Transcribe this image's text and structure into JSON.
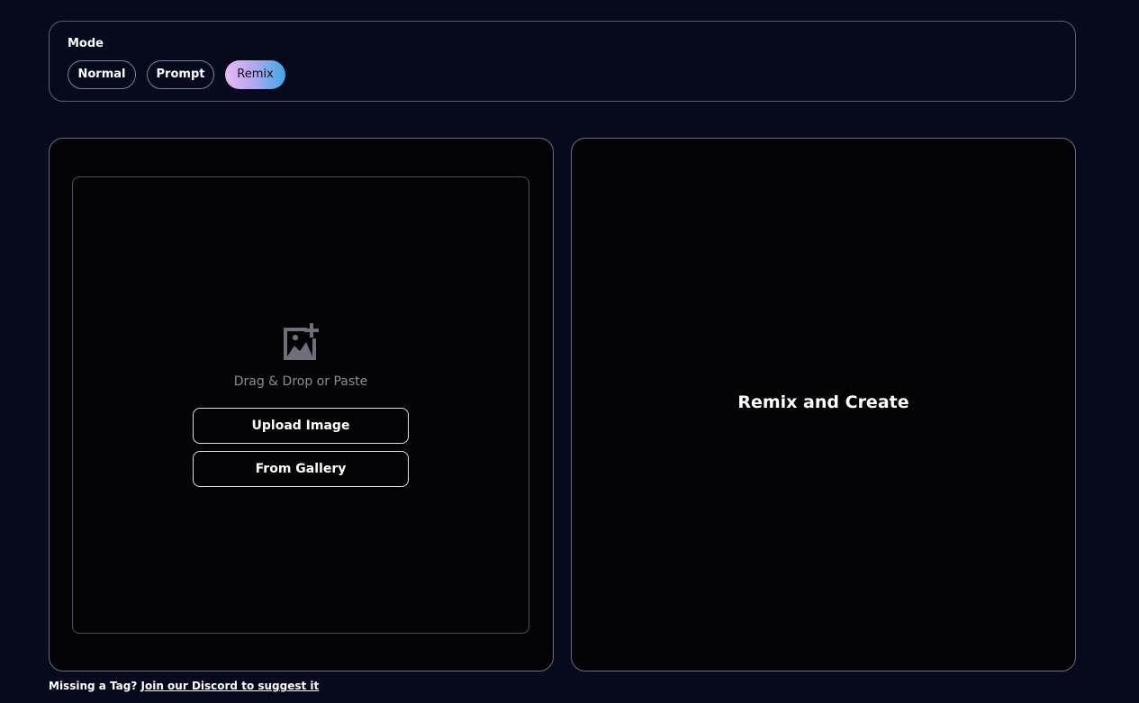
{
  "mode": {
    "label": "Mode",
    "options": [
      "Normal",
      "Prompt",
      "Remix"
    ],
    "selected": "Remix",
    "selected_gradient": [
      "#e8b8f5",
      "#b8a8f0",
      "#3fa7e6"
    ]
  },
  "upload": {
    "icon": "image-plus-icon",
    "drag_text": "Drag & Drop or Paste",
    "upload_button": "Upload Image",
    "gallery_button": "From Gallery"
  },
  "output": {
    "title": "Remix and Create"
  },
  "footer": {
    "question": "Missing a Tag?",
    "link_text": "Join our Discord to suggest it"
  }
}
